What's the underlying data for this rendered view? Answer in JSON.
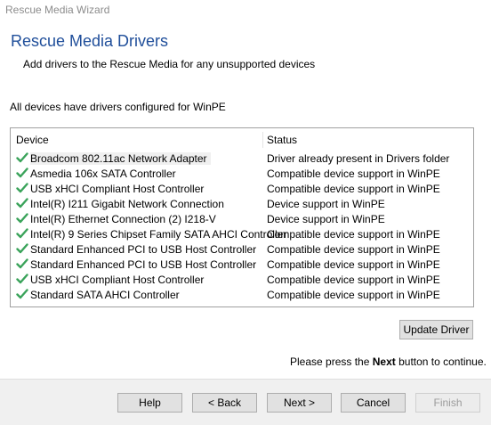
{
  "window": {
    "title": "Rescue Media Wizard"
  },
  "header": {
    "title": "Rescue Media Drivers",
    "subtitle": "Add drivers to the Rescue Media for any unsupported devices"
  },
  "status_message": "All devices have drivers configured for WinPE",
  "device_list": {
    "columns": [
      "Device",
      "Status"
    ],
    "rows": [
      {
        "device": "Broadcom 802.11ac Network Adapter",
        "status": "Driver already present in Drivers folder"
      },
      {
        "device": "Asmedia 106x SATA Controller",
        "status": "Compatible device support in WinPE"
      },
      {
        "device": "USB xHCI Compliant Host Controller",
        "status": "Compatible device support in WinPE"
      },
      {
        "device": "Intel(R) I211 Gigabit Network Connection",
        "status": "Device support in WinPE"
      },
      {
        "device": "Intel(R) Ethernet Connection (2) I218-V",
        "status": "Device support in WinPE"
      },
      {
        "device": "Intel(R) 9 Series Chipset Family SATA AHCI Controller",
        "status": "Compatible device support in WinPE"
      },
      {
        "device": "Standard Enhanced PCI to USB Host Controller",
        "status": "Compatible device support in WinPE"
      },
      {
        "device": "Standard Enhanced PCI to USB Host Controller",
        "status": "Compatible device support in WinPE"
      },
      {
        "device": "USB xHCI Compliant Host Controller",
        "status": "Compatible device support in WinPE"
      },
      {
        "device": "Standard SATA AHCI Controller",
        "status": "Compatible device support in WinPE"
      }
    ],
    "row_icon": "checkmark-icon"
  },
  "update_driver_label": "Update Driver",
  "continue_hint": {
    "prefix": "Please press the",
    "emphasis": "Next",
    "suffix": "button to continue."
  },
  "footer": {
    "help_label": "Help",
    "back_label": "< Back",
    "next_label": "Next >",
    "cancel_label": "Cancel",
    "finish_label": "Finish"
  },
  "colors": {
    "heading": "#1f4e9a",
    "check": "#3aa35a"
  }
}
